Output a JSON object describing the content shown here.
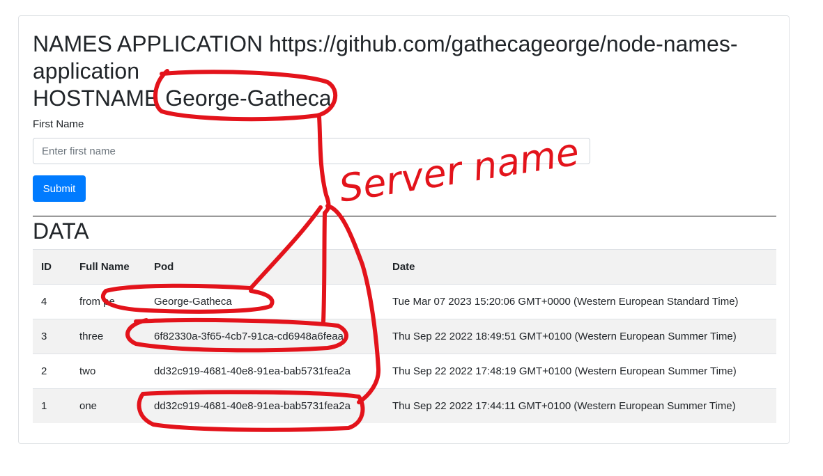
{
  "header": {
    "title_line1": "NAMES APPLICATION https://github.com/gathecageorge/node-names-",
    "title_line2": "application",
    "hostname_label": "HOSTNAME",
    "hostname_value": "George-Gatheca"
  },
  "form": {
    "first_name_label": "First Name",
    "first_name_placeholder": "Enter first name",
    "first_name_value": "",
    "submit_label": "Submit"
  },
  "data_section": {
    "heading": "DATA",
    "columns": [
      "ID",
      "Full Name",
      "Pod",
      "Date"
    ],
    "rows": [
      {
        "id": "4",
        "full_name": "from pe",
        "pod": "George-Gatheca",
        "date": "Tue Mar 07 2023 15:20:06 GMT+0000 (Western European Standard Time)"
      },
      {
        "id": "3",
        "full_name": "three",
        "pod": "6f82330a-3f65-4cb7-91ca-cd6948a6feaa",
        "date": "Thu Sep 22 2022 18:49:51 GMT+0100 (Western European Summer Time)"
      },
      {
        "id": "2",
        "full_name": "two",
        "pod": "dd32c919-4681-40e8-91ea-bab5731fea2a",
        "date": "Thu Sep 22 2022 17:48:19 GMT+0100 (Western European Summer Time)"
      },
      {
        "id": "1",
        "full_name": "one",
        "pod": "dd32c919-4681-40e8-91ea-bab5731fea2a",
        "date": "Thu Sep 22 2022 17:44:11 GMT+0100 (Western European Summer Time)"
      }
    ]
  },
  "annotation": {
    "text": "Server name",
    "color": "#e3131b"
  },
  "colors": {
    "primary_button": "#007bff",
    "stripe": "#f2f2f2"
  }
}
